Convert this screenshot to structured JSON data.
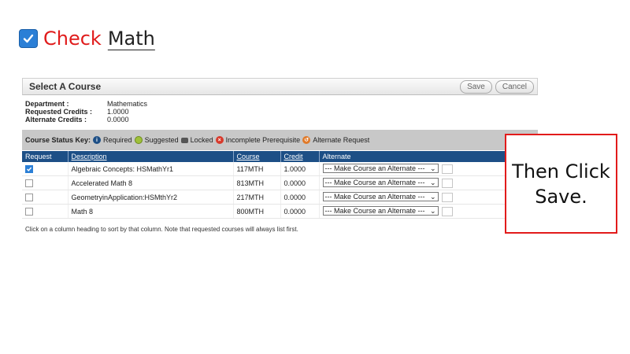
{
  "heading": {
    "word1": "Check",
    "word2": "Math",
    "accent_color": "#e01b1b",
    "checkbox_color": "#2b7fd6"
  },
  "panel": {
    "title": "Select A Course",
    "buttons": {
      "save": "Save",
      "cancel": "Cancel"
    },
    "info": [
      {
        "label": "Department :",
        "value": "Mathematics"
      },
      {
        "label": "Requested Credits :",
        "value": "1.0000"
      },
      {
        "label": "Alternate Credits :",
        "value": "0.0000"
      }
    ],
    "status_key": {
      "title": "Course Status Key:",
      "items": [
        {
          "icon": "info-icon",
          "label": "Required"
        },
        {
          "icon": "suggested-icon",
          "label": "Suggested"
        },
        {
          "icon": "lock-icon",
          "label": "Locked"
        },
        {
          "icon": "error-icon",
          "label": "Incomplete Prerequisite"
        },
        {
          "icon": "alternate-icon",
          "label": "Alternate Request"
        }
      ]
    },
    "table": {
      "headers": {
        "request": "Request",
        "description": "Description",
        "course": "Course",
        "credit": "Credit",
        "alternate": "Alternate"
      },
      "rows": [
        {
          "checked": true,
          "description": "Algebraic Concepts: HSMathYr1",
          "course": "117MTH",
          "credit": "1.0000",
          "alternate": "--- Make Course an Alternate ---"
        },
        {
          "checked": false,
          "description": "Accelerated Math 8",
          "course": "813MTH",
          "credit": "0.0000",
          "alternate": "--- Make Course an Alternate ---"
        },
        {
          "checked": false,
          "description": "GeometryinApplication:HSMthYr2",
          "course": "217MTH",
          "credit": "0.0000",
          "alternate": "--- Make Course an Alternate ---"
        },
        {
          "checked": false,
          "description": "Math 8",
          "course": "800MTH",
          "credit": "0.0000",
          "alternate": "--- Make Course an Alternate ---"
        }
      ]
    },
    "note": "Click on a column heading to sort by that column. Note that requested courses will always list first."
  },
  "callout": {
    "line1": "Then Click",
    "line2": "Save.",
    "border_color": "#e21b1b"
  }
}
